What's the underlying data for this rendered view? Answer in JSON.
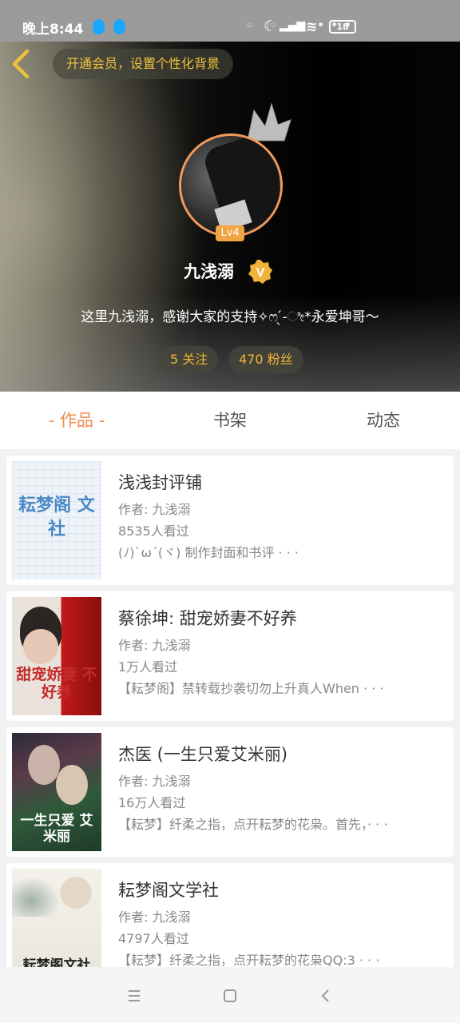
{
  "status_bar": {
    "time": "晚上8:44",
    "battery": "18"
  },
  "header": {
    "vip_prompt": "开通会员，设置个性化背景",
    "level": "Lv4",
    "username": "九浅溺",
    "verified_badge": "V",
    "bio": "这里九浅溺，感谢大家的支持✧ෆ ̖́-ೀ*永爱坤哥～",
    "following": "5 关注",
    "followers": "470 粉丝"
  },
  "tabs": [
    {
      "label": "- 作品 -",
      "active": true
    },
    {
      "label": "书架",
      "active": false
    },
    {
      "label": "动态",
      "active": false
    }
  ],
  "works": [
    {
      "title": "浅浅封评铺",
      "author": "作者: 九浅溺",
      "views": "8535人看过",
      "desc": "(ﾉ)`ω´(ヾ) 制作封面和书评 · · ·",
      "cover_text": "耘梦阁 文社"
    },
    {
      "title": "蔡徐坤: 甜宠娇妻不好养",
      "author": "作者: 九浅溺",
      "views": "1万人看过",
      "desc": "【耘梦阁】禁转载抄袭切勿上升真人When · · ·",
      "cover_text": "甜宠娇妻 不好养"
    },
    {
      "title": "杰医 (一生只爱艾米丽)",
      "author": "作者: 九浅溺",
      "views": "16万人看过",
      "desc": "【耘梦】纤柔之指，点开耘梦的花枭。首先，· · ·",
      "cover_text": "一生只爱 艾米丽"
    },
    {
      "title": "耘梦阁文学社",
      "author": "作者: 九浅溺",
      "views": "4797人看过",
      "desc": "【耘梦】纤柔之指，点开耘梦的花枭QQ:3 · · ·",
      "cover_text": "耘梦阁文社"
    }
  ],
  "colors": {
    "accent": "#f08b4e",
    "gold": "#f2c53d",
    "level_badge": "#f0a444"
  }
}
